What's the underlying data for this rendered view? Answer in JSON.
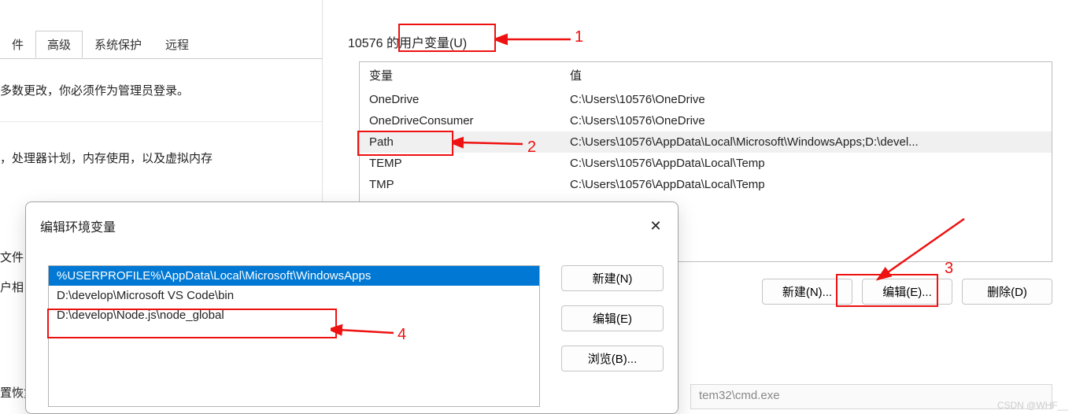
{
  "left_window": {
    "tabs": [
      {
        "label": "件",
        "active": false
      },
      {
        "label": "高级",
        "active": true
      },
      {
        "label": "系统保护",
        "active": false
      },
      {
        "label": "远程",
        "active": false
      }
    ],
    "admin_note": "多数更改，你必须作为管理员登录。",
    "performance_note": "，处理器计划，内存使用，以及虚拟内存",
    "label_file": "文件",
    "label_user": "户相",
    "label_restore": "置恢复"
  },
  "env_window": {
    "section_title": "10576 的用户变量(U)",
    "columns": {
      "variable": "变量",
      "value": "值"
    },
    "rows": [
      {
        "name": "OneDrive",
        "value": "C:\\Users\\10576\\OneDrive",
        "selected": false
      },
      {
        "name": "OneDriveConsumer",
        "value": "C:\\Users\\10576\\OneDrive",
        "selected": false
      },
      {
        "name": "Path",
        "value": "C:\\Users\\10576\\AppData\\Local\\Microsoft\\WindowsApps;D:\\devel...",
        "selected": true
      },
      {
        "name": "TEMP",
        "value": "C:\\Users\\10576\\AppData\\Local\\Temp",
        "selected": false
      },
      {
        "name": "TMP",
        "value": "C:\\Users\\10576\\AppData\\Local\\Temp",
        "selected": false
      }
    ],
    "buttons": {
      "new": "新建(N)...",
      "edit": "编辑(E)...",
      "delete": "删除(D)"
    },
    "disabled_path": "tem32\\cmd.exe"
  },
  "edit_dialog": {
    "title": "编辑环境变量",
    "close": "✕",
    "items": [
      {
        "text": "%USERPROFILE%\\AppData\\Local\\Microsoft\\WindowsApps",
        "selected": true
      },
      {
        "text": "D:\\develop\\Microsoft VS Code\\bin",
        "selected": false
      },
      {
        "text": "D:\\develop\\Node.js\\node_global",
        "selected": false
      }
    ],
    "buttons": {
      "new": "新建(N)",
      "edit": "编辑(E)",
      "browse": "浏览(B)..."
    }
  },
  "annotations": {
    "n1": "1",
    "n2": "2",
    "n3": "3",
    "n4": "4"
  },
  "watermark": "CSDN @WHF__"
}
